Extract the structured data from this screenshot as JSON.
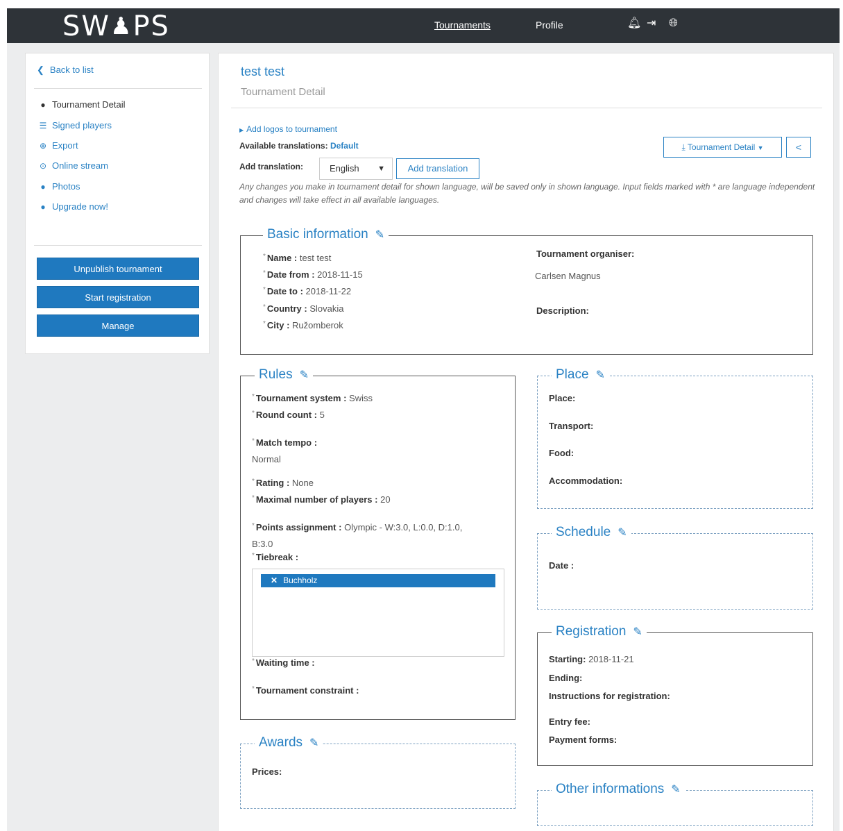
{
  "header": {
    "logo_text_left": "SW",
    "logo_text_right": "PS",
    "logo_icon": "chess-pawn-icon",
    "nav": [
      {
        "label": "Tournaments",
        "active": true
      },
      {
        "label": "Profile",
        "active": false
      }
    ],
    "icons": [
      "bell-icon",
      "sign-out-icon",
      "globe-icon"
    ]
  },
  "sidebar": {
    "back_label": "Back to list",
    "items": [
      {
        "label": "Tournament Detail",
        "icon": "info-circle-icon"
      },
      {
        "label": "Signed players",
        "icon": "list-icon"
      },
      {
        "label": "Export",
        "icon": "download-circle-icon"
      },
      {
        "label": "Online stream",
        "icon": "play-circle-icon"
      },
      {
        "label": "Photos",
        "icon": "camera-icon"
      },
      {
        "label": "Upgrade now!",
        "icon": "up-circle-icon"
      }
    ],
    "buttons": [
      "Unpublish tournament",
      "Start registration",
      "Manage"
    ]
  },
  "main": {
    "title": "test test",
    "subtitle": "Tournament Detail",
    "add_logos": "Add logos to tournament",
    "available_translations_label": "Available translations:",
    "available_translations_value": "Default",
    "add_translation_label": "Add translation:",
    "language_select": "English",
    "add_translation_button": "Add translation",
    "detail_dropdown": "Tournament Detail",
    "note": "Any changes you make in tournament detail for shown language, will be saved only in shown language. Input fields marked with * are language independent and changes will take effect in all available languages."
  },
  "basic_info": {
    "legend": "Basic information",
    "name_label": "Name :",
    "name_value": "test test",
    "date_from_label": "Date from :",
    "date_from_value": "2018-11-15",
    "date_to_label": "Date to :",
    "date_to_value": "2018-11-22",
    "country_label": "Country :",
    "country_value": "Slovakia",
    "city_label": "City :",
    "city_value": "Ružomberok",
    "organiser_label": "Tournament organiser:",
    "organiser_value": "Carlsen Magnus",
    "description_label": "Description:"
  },
  "rules": {
    "legend": "Rules",
    "system_label": "Tournament system :",
    "system_value": "Swiss",
    "rounds_label": "Round count :",
    "rounds_value": "5",
    "tempo_label": "Match tempo :",
    "tempo_value": "Normal",
    "rating_label": "Rating :",
    "rating_value": "None",
    "max_players_label": "Maximal number of players :",
    "max_players_value": "20",
    "points_label": "Points assignment :",
    "points_value": "Olympic - W:3.0, L:0.0, D:1.0,",
    "points_value_2": "B:3.0",
    "tiebreak_label": "Tiebreak :",
    "tiebreak_tag": "Buchholz",
    "waiting_label": "Waiting time :",
    "constraint_label": "Tournament constraint :"
  },
  "place": {
    "legend": "Place",
    "place_label": "Place:",
    "transport_label": "Transport:",
    "food_label": "Food:",
    "accommodation_label": "Accommodation:"
  },
  "schedule": {
    "legend": "Schedule",
    "date_label": "Date :"
  },
  "registration": {
    "legend": "Registration",
    "starting_label": "Starting:",
    "starting_value": "2018-11-21",
    "ending_label": "Ending:",
    "instructions_label": "Instructions for registration:",
    "fee_label": "Entry fee:",
    "payment_label": "Payment forms:"
  },
  "awards": {
    "legend": "Awards",
    "prices_label": "Prices:"
  },
  "other": {
    "legend": "Other informations"
  },
  "colors": {
    "accent": "#2a82c4",
    "button": "#1f79bf",
    "topbar": "#2e3338"
  }
}
